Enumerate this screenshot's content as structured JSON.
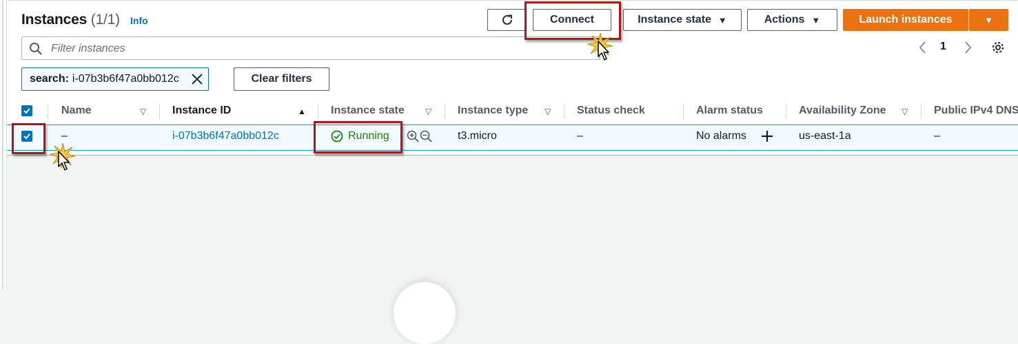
{
  "header": {
    "title": "Instances",
    "count": "(1/1)",
    "info_link": "Info"
  },
  "toolbar": {
    "connect_label": "Connect",
    "instance_state_label": "Instance state",
    "actions_label": "Actions",
    "launch_label": "Launch instances"
  },
  "filter": {
    "placeholder": "Filter instances"
  },
  "pagination": {
    "current_page": "1"
  },
  "active_filter": {
    "key": "search:",
    "value": "i-07b3b6f47a0bb012c",
    "clear_label": "Clear filters"
  },
  "table": {
    "columns": [
      "Name",
      "Instance ID",
      "Instance state",
      "Instance type",
      "Status check",
      "Alarm status",
      "Availability Zone",
      "Public IPv4 DNS"
    ],
    "rows": [
      {
        "name": "–",
        "instance_id": "i-07b3b6f47a0bb012c",
        "instance_state": "Running",
        "instance_type": "t3.micro",
        "status_check": "–",
        "alarm_status": "No alarms",
        "availability_zone": "us-east-1a",
        "public_dns": "–"
      }
    ]
  },
  "colors": {
    "primary": "#ec7211",
    "link": "#0073bb",
    "success": "#1d8102",
    "highlight": "#b0151b"
  }
}
